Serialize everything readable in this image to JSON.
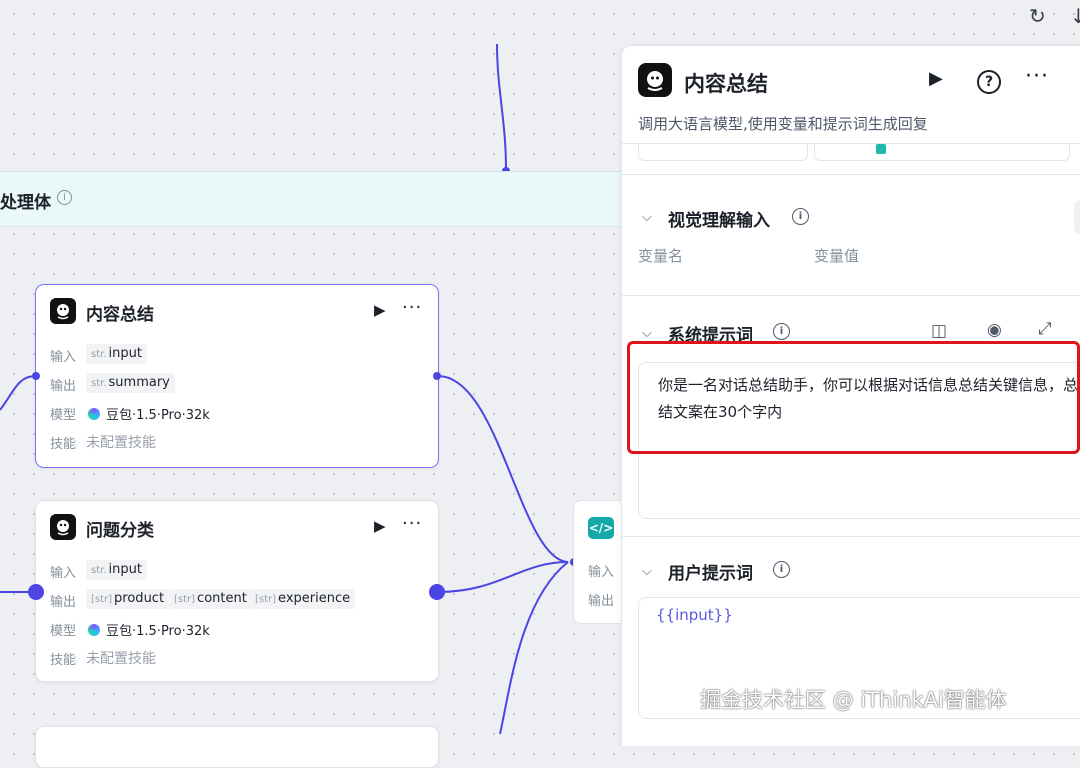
{
  "toolbar": {
    "refresh_icon": "refresh-icon",
    "download_icon": "download-icon"
  },
  "group": {
    "title": "处理体",
    "info_glyph": "i"
  },
  "nodes": [
    {
      "title": "内容总结",
      "input_label": "输入",
      "input_tags": [
        {
          "type": "str.",
          "name": "input"
        }
      ],
      "output_label": "输出",
      "output_tags": [
        {
          "type": "str.",
          "name": "summary"
        }
      ],
      "model_label": "模型",
      "model": "豆包·1.5·Pro·32k",
      "skill_label": "技能",
      "skill": "未配置技能"
    },
    {
      "title": "问题分类",
      "input_label": "输入",
      "input_tags": [
        {
          "type": "str.",
          "name": "input"
        }
      ],
      "output_label": "输出",
      "output_tags": [
        {
          "type": "[str]",
          "name": "product"
        },
        {
          "type": "[str]",
          "name": "content"
        },
        {
          "type": "[str]",
          "name": "experience"
        }
      ],
      "model_label": "模型",
      "model": "豆包·1.5·Pro·32k",
      "skill_label": "技能",
      "skill": "未配置技能"
    }
  ],
  "code_node": {
    "input_label": "输入",
    "output_label": "输出",
    "icon": "</>"
  },
  "panel": {
    "title": "内容总结",
    "description": "调用大语言模型,使用变量和提示词生成回复",
    "vision_section": {
      "title": "视觉理解输入",
      "col_name": "变量名",
      "col_value": "变量值"
    },
    "system_prompt": {
      "title": "系统提示词",
      "text": "你是一名对话总结助手，你可以根据对话信息总结关键信息，总结文案在30个字内"
    },
    "user_prompt": {
      "title": "用户提示词",
      "text": "{{input}}"
    }
  },
  "watermark": "掘金技术社区 @ iThinkAi智能体",
  "colors": {
    "accent": "#4b45e6",
    "highlight_border": "#e0141b",
    "code_node": "#14a8a8"
  }
}
